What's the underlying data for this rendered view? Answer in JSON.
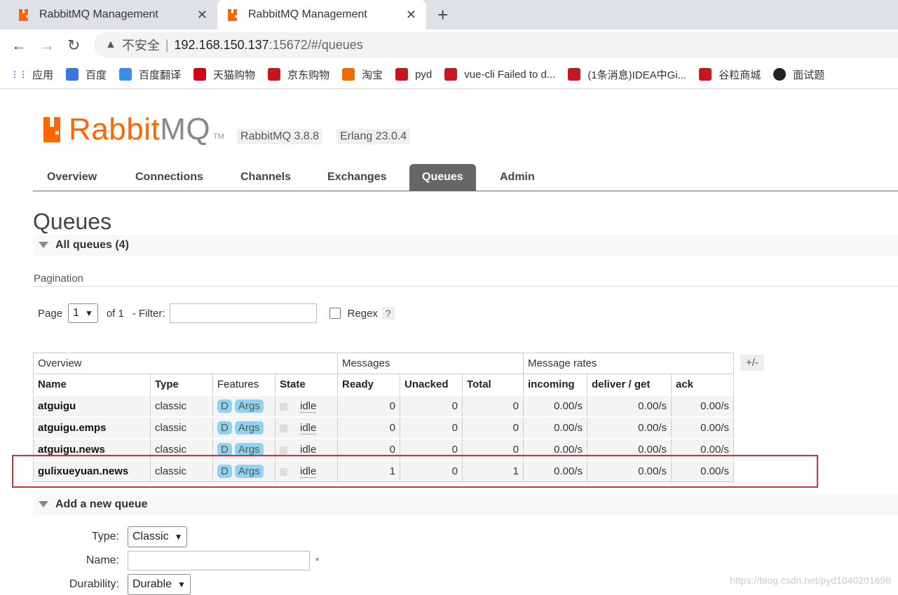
{
  "browser": {
    "tabs": [
      {
        "title": "RabbitMQ Management",
        "active": false
      },
      {
        "title": "RabbitMQ Management",
        "active": true
      }
    ],
    "address": {
      "security": "不安全",
      "host": "192.168.150.137",
      "path": ":15672/#/queues"
    },
    "bookmarks": [
      {
        "label": "应用",
        "icon": "apps-icon",
        "color": "#4285f4"
      },
      {
        "label": "百度",
        "icon": "baidu-icon",
        "color": "#3a75e0"
      },
      {
        "label": "百度翻译",
        "icon": "translate-icon",
        "color": "#3a8ee6"
      },
      {
        "label": "天猫购物",
        "icon": "tmall-icon",
        "color": "#d0021b"
      },
      {
        "label": "京东购物",
        "icon": "jd-icon",
        "color": "#c9151e"
      },
      {
        "label": "淘宝",
        "icon": "taobao-icon",
        "color": "#f56a00"
      },
      {
        "label": "pyd",
        "icon": "csdn-icon",
        "color": "#c9151e"
      },
      {
        "label": "vue-cli Failed to d...",
        "icon": "csdn-icon",
        "color": "#c9151e"
      },
      {
        "label": "(1条消息)IDEA中Gi...",
        "icon": "csdn-icon",
        "color": "#c9151e"
      },
      {
        "label": "谷粒商城",
        "icon": "csdn-icon",
        "color": "#c9151e"
      },
      {
        "label": "面试题",
        "icon": "github-icon",
        "color": "#222222"
      }
    ]
  },
  "header": {
    "logo_rabbit": "Rabbit",
    "logo_mq": "MQ",
    "logo_tm": "TM",
    "version_rabbit": "RabbitMQ 3.8.8",
    "version_erlang": "Erlang 23.0.4"
  },
  "nav": {
    "tabs": [
      "Overview",
      "Connections",
      "Channels",
      "Exchanges",
      "Queues",
      "Admin"
    ],
    "active": "Queues"
  },
  "page": {
    "title": "Queues",
    "all_queues_label": "All queues (4)",
    "pagination_label": "Pagination",
    "page_label": "Page",
    "page_value": "1",
    "of_label": "of 1",
    "filter_label": "- Filter:",
    "regex_label": "Regex",
    "help_label": "?"
  },
  "table": {
    "groups": {
      "overview": "Overview",
      "messages": "Messages",
      "rates": "Message rates"
    },
    "toggle": "+/-",
    "headers": [
      "Name",
      "Type",
      "Features",
      "State",
      "Ready",
      "Unacked",
      "Total",
      "incoming",
      "deliver / get",
      "ack"
    ],
    "rows": [
      {
        "name": "atguigu",
        "type": "classic",
        "d": "D",
        "args": "Args",
        "state": "idle",
        "ready": "0",
        "unacked": "0",
        "total": "0",
        "incoming": "0.00/s",
        "deliver": "0.00/s",
        "ack": "0.00/s"
      },
      {
        "name": "atguigu.emps",
        "type": "classic",
        "d": "D",
        "args": "Args",
        "state": "idle",
        "ready": "0",
        "unacked": "0",
        "total": "0",
        "incoming": "0.00/s",
        "deliver": "0.00/s",
        "ack": "0.00/s"
      },
      {
        "name": "atguigu.news",
        "type": "classic",
        "d": "D",
        "args": "Args",
        "state": "idle",
        "ready": "0",
        "unacked": "0",
        "total": "0",
        "incoming": "0.00/s",
        "deliver": "0.00/s",
        "ack": "0.00/s"
      },
      {
        "name": "gulixueyuan.news",
        "type": "classic",
        "d": "D",
        "args": "Args",
        "state": "idle",
        "ready": "1",
        "unacked": "0",
        "total": "1",
        "incoming": "0.00/s",
        "deliver": "0.00/s",
        "ack": "0.00/s"
      }
    ]
  },
  "add_queue": {
    "title": "Add a new queue",
    "type_label": "Type:",
    "type_value": "Classic",
    "name_label": "Name:",
    "name_required": "*",
    "durability_label": "Durability:",
    "durability_value": "Durable"
  },
  "watermark": "https://blog.csdn.net/pyd1040201698"
}
